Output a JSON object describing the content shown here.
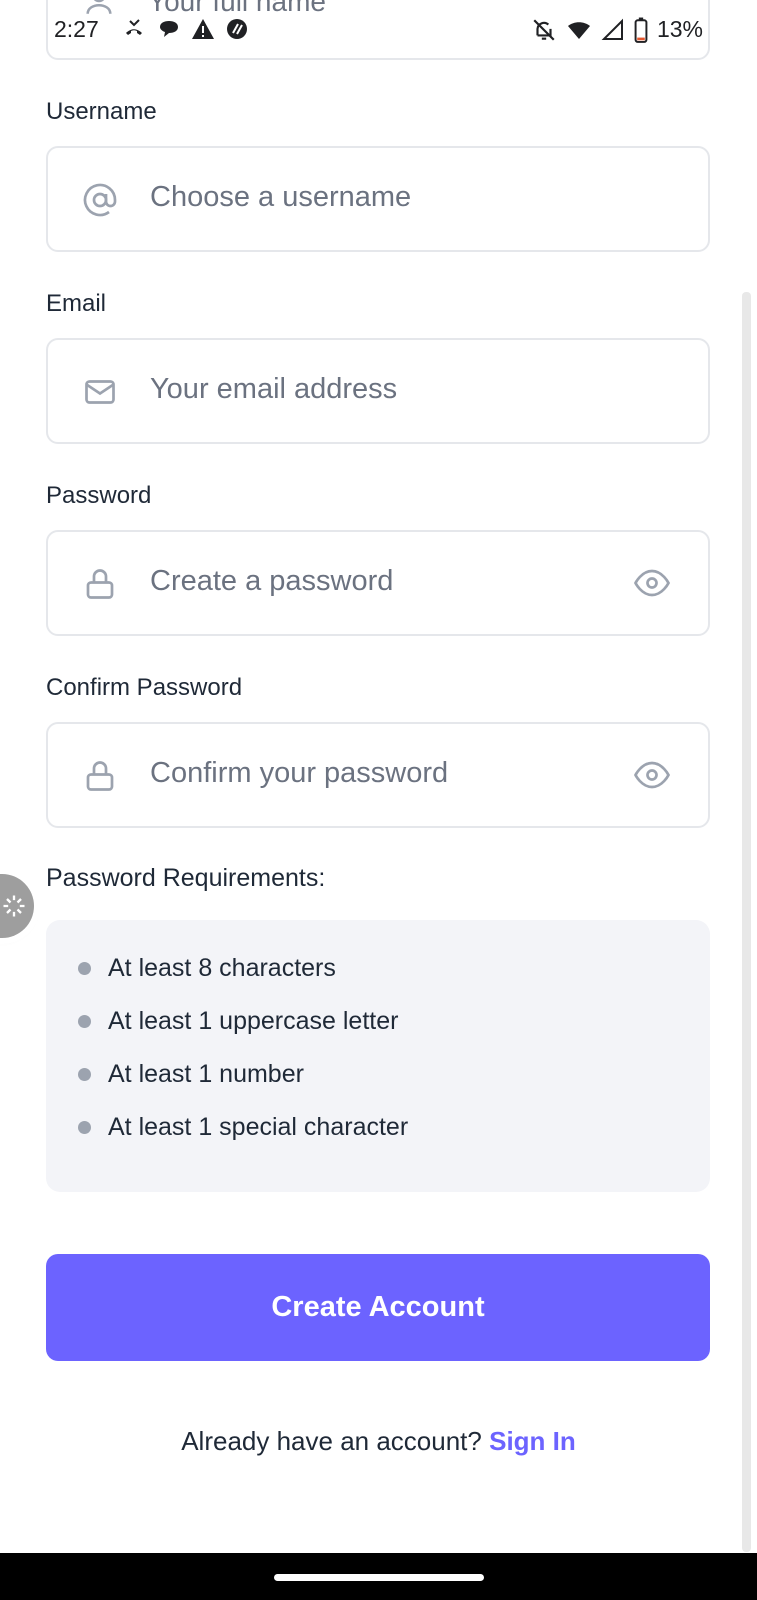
{
  "status_bar": {
    "time": "2:27",
    "battery": "13%"
  },
  "form": {
    "full_name": {
      "placeholder": "Your full name"
    },
    "username": {
      "label": "Username",
      "placeholder": "Choose a username"
    },
    "email": {
      "label": "Email",
      "placeholder": "Your email address"
    },
    "password": {
      "label": "Password",
      "placeholder": "Create a password"
    },
    "confirm_password": {
      "label": "Confirm Password",
      "placeholder": "Confirm your password"
    }
  },
  "requirements": {
    "title": "Password Requirements:",
    "items": [
      "At least 8 characters",
      "At least 1 uppercase letter",
      "At least 1 number",
      "At least 1 special character"
    ]
  },
  "cta": {
    "label": "Create Account"
  },
  "footer": {
    "prompt": "Already have an account?",
    "link": "Sign In"
  },
  "colors": {
    "accent": "#6c63ff",
    "border": "#e5e7eb",
    "requirements_bg": "#f3f4f8"
  }
}
